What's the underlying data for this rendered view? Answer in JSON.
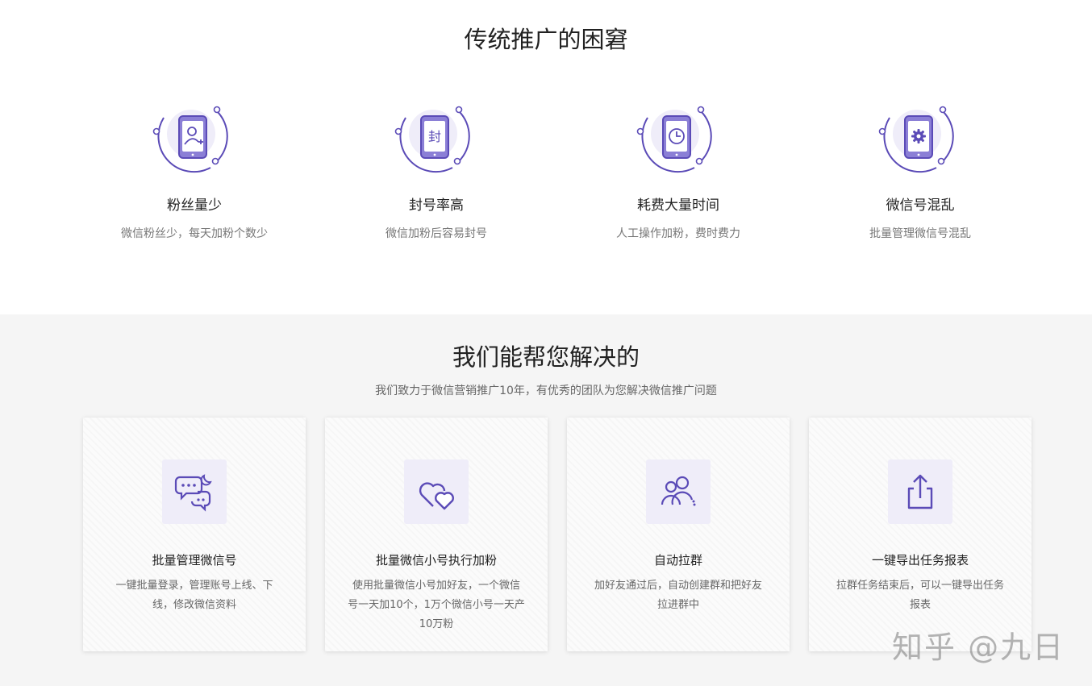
{
  "pain": {
    "title": "传统推广的困窘",
    "items": [
      {
        "icon": "user-add-phone-icon",
        "label": "粉丝量少",
        "desc": "微信粉丝少，每天加粉个数少"
      },
      {
        "icon": "ban-phone-icon",
        "glyph": "封",
        "label": "封号率高",
        "desc": "微信加粉后容易封号"
      },
      {
        "icon": "clock-phone-icon",
        "label": "耗费大量时间",
        "desc": "人工操作加粉，费时费力"
      },
      {
        "icon": "gear-phone-icon",
        "label": "微信号混乱",
        "desc": "批量管理微信号混乱"
      }
    ]
  },
  "solution": {
    "title": "我们能帮您解决的",
    "subtitle": "我们致力于微信营销推广10年，有优秀的团队为您解决微信推广问题",
    "cards": [
      {
        "icon": "chat-bubbles-icon",
        "title": "批量管理微信号",
        "desc": "一键批量登录，管理账号上线、下线，修改微信资料"
      },
      {
        "icon": "hearts-icon",
        "title": "批量微信小号执行加粉",
        "desc": "使用批量微信小号加好友，一个微信号一天加10个，1万个微信小号一天产10万粉"
      },
      {
        "icon": "users-group-icon",
        "title": "自动拉群",
        "desc": "加好友通过后，自动创建群和把好友拉进群中"
      },
      {
        "icon": "export-share-icon",
        "title": "一键导出任务报表",
        "desc": "拉群任务结束后，可以一键导出任务报表"
      }
    ]
  },
  "watermark": "知乎 @九日",
  "colors": {
    "accent": "#5b4bb7",
    "accent_light": "#efedf9",
    "gray_bg": "#f5f5f5"
  }
}
